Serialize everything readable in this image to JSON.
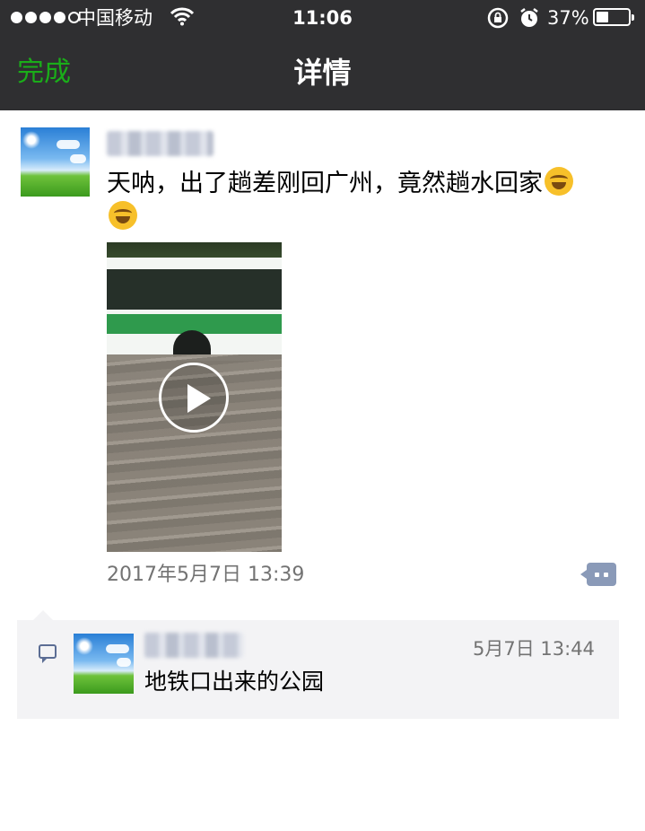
{
  "status_bar": {
    "carrier": "中国移动",
    "time": "11:06",
    "battery_percent": "37%",
    "battery_level": 0.37,
    "signal_bars_filled": 4,
    "signal_bars_total": 5
  },
  "nav": {
    "done_label": "完成",
    "title": "详情"
  },
  "post": {
    "text": "天呐，出了趟差刚回广州，竟然趟水回家",
    "emoji": [
      "face-with-tears-of-joy",
      "face-with-tears-of-joy"
    ],
    "timestamp": "2017年5月7日 13:39"
  },
  "comments": [
    {
      "timestamp": "5月7日 13:44",
      "text": "地铁口出来的公园"
    }
  ],
  "colors": {
    "nav_background": "#2f2f31",
    "accent_green": "#1aad19",
    "comment_background": "#f3f3f5",
    "link_blue": "#5b6d94"
  }
}
